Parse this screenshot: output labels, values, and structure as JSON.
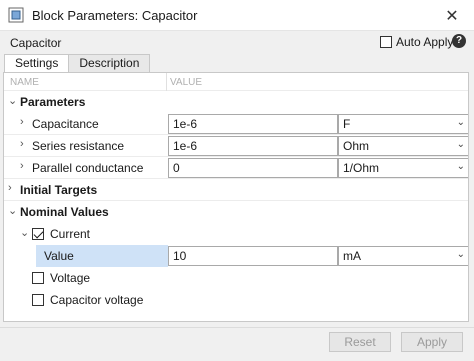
{
  "window": {
    "title": "Block Parameters: Capacitor",
    "close_glyph": "✕"
  },
  "header": {
    "block_name": "Capacitor",
    "auto_apply_label": "Auto Apply",
    "auto_apply_checked": false,
    "help_glyph": "?"
  },
  "tabs": [
    {
      "label": "Settings",
      "active": true
    },
    {
      "label": "Description",
      "active": false
    }
  ],
  "table": {
    "name_header": "NAME",
    "value_header": "VALUE"
  },
  "parameters": {
    "label": "Parameters",
    "rows": [
      {
        "label": "Capacitance",
        "value": "1e-6",
        "unit": "F"
      },
      {
        "label": "Series resistance",
        "value": "1e-6",
        "unit": "Ohm"
      },
      {
        "label": "Parallel conductance",
        "value": "0",
        "unit": "1/Ohm"
      }
    ]
  },
  "initial_targets": {
    "label": "Initial Targets"
  },
  "nominal_values": {
    "label": "Nominal Values",
    "current": {
      "label": "Current",
      "checked": true,
      "value_label": "Value",
      "value": "10",
      "unit": "mA"
    },
    "voltage": {
      "label": "Voltage",
      "checked": false
    },
    "capacitor_voltage": {
      "label": "Capacitor voltage",
      "checked": false
    }
  },
  "footer": {
    "reset_label": "Reset",
    "apply_label": "Apply"
  },
  "icons": {
    "expanded": "chevron-down-icon",
    "collapsed": "chevron-right-icon",
    "dropdown": "dropdown-arrow-icon"
  },
  "colors": {
    "selection": "#cfe2f7",
    "disabled_text": "#9a9a9a"
  }
}
